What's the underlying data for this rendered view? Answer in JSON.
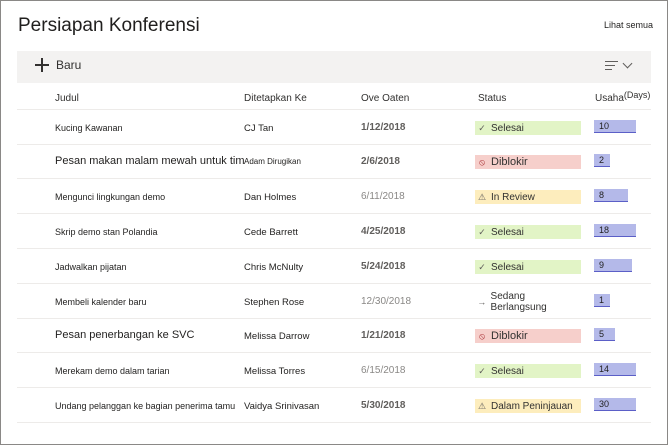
{
  "header": {
    "title": "Persiapan Konferensi",
    "see_all": "Lihat semua"
  },
  "toolbar": {
    "new_label": "Baru"
  },
  "columns": {
    "title": "Judul",
    "assigned": "Ditetapkan Ke",
    "due": "Ove Oaten",
    "status": "Status",
    "effort": "Usaha",
    "effort_unit": "(Days)"
  },
  "rows": [
    {
      "title": "Kucing Kawanan",
      "assigned": "CJ Tan",
      "due": "1/12/2018",
      "status": "Selesai",
      "status_kind": "green",
      "status_icon": "check-icon",
      "effort": "10",
      "effort_fraction": 1.0
    },
    {
      "title": "Pesan makan malam mewah untuk tim",
      "assigned": "Adam Dirugikan",
      "due": "2/6/2018",
      "status": "Diblokir",
      "status_kind": "red",
      "status_icon": "blocked-icon",
      "effort": "2",
      "effort_fraction": 0.2
    },
    {
      "title": "Mengunci lingkungan demo",
      "assigned": "Dan Holmes",
      "due": "6/11/2018",
      "status": "In Review",
      "status_kind": "yellow",
      "status_icon": "warning-icon",
      "effort": "8",
      "effort_fraction": 0.8
    },
    {
      "title": "Skrip demo stan Polandia",
      "assigned": "Cede Barrett",
      "due": "4/25/2018",
      "status": "Selesai",
      "status_kind": "green",
      "status_icon": "check-icon",
      "effort": "18",
      "effort_fraction": 1.0
    },
    {
      "title": "Jadwalkan pijatan",
      "assigned": "Chris McNulty",
      "due": "5/24/2018",
      "status": "Selesai",
      "status_kind": "green",
      "status_icon": "check-icon",
      "effort": "9",
      "effort_fraction": 0.9
    },
    {
      "title": "Membeli kalender baru",
      "assigned": "Stephen Rose",
      "due": "12/30/2018",
      "status": "Sedang Berlangsung",
      "status_kind": "plain",
      "status_icon": "arrow-right-icon",
      "effort": "1",
      "effort_fraction": 0.1
    },
    {
      "title": "Pesan penerbangan ke SVC",
      "assigned": "Melissa Darrow",
      "due": "1/21/2018",
      "status": "Diblokir",
      "status_kind": "red",
      "status_icon": "blocked-icon",
      "effort": "5",
      "effort_fraction": 0.5
    },
    {
      "title": "Merekam demo dalam tarian",
      "assigned": "Melissa Torres",
      "due": "6/15/2018",
      "status": "Selesai",
      "status_kind": "green",
      "status_icon": "check-icon",
      "effort": "14",
      "effort_fraction": 1.0
    },
    {
      "title": "Undang pelanggan ke bagian penerima tamu",
      "assigned": "Vaidya Srinivasan",
      "due": "5/30/2018",
      "status": "Dalam Peninjauan",
      "status_kind": "yellow",
      "status_icon": "warning-icon",
      "effort": "30",
      "effort_fraction": 1.0
    }
  ]
}
